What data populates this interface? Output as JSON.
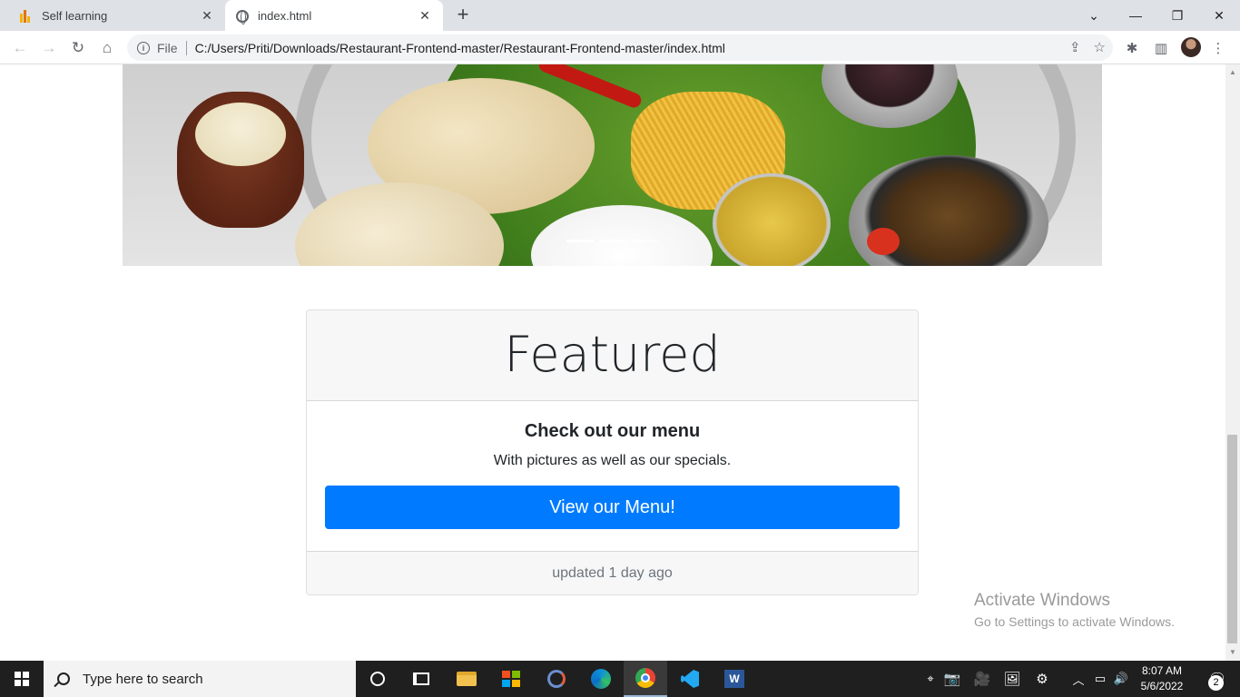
{
  "browser": {
    "tabs": [
      {
        "title": "Self learning",
        "active": false,
        "icon": "bar-chart-icon"
      },
      {
        "title": "index.html",
        "active": true,
        "icon": "globe-icon"
      }
    ],
    "omnibox": {
      "scheme_label": "File",
      "url": "C:/Users/Priti/Downloads/Restaurant-Frontend-master/Restaurant-Frontend-master/index.html"
    },
    "accent": "#007bff"
  },
  "page": {
    "carousel": {
      "slide_count": 3,
      "active_index": 0
    },
    "card": {
      "header": "Featured",
      "title": "Check out our menu",
      "text": "With pictures as well as our specials.",
      "button_label": "View our Menu!",
      "footer": "updated 1 day ago"
    },
    "watermark": {
      "line1": "Activate Windows",
      "line2": "Go to Settings to activate Windows."
    }
  },
  "taskbar": {
    "search_placeholder": "Type here to search",
    "time": "8:07 AM",
    "date": "5/6/2022",
    "notification_count": "2"
  }
}
